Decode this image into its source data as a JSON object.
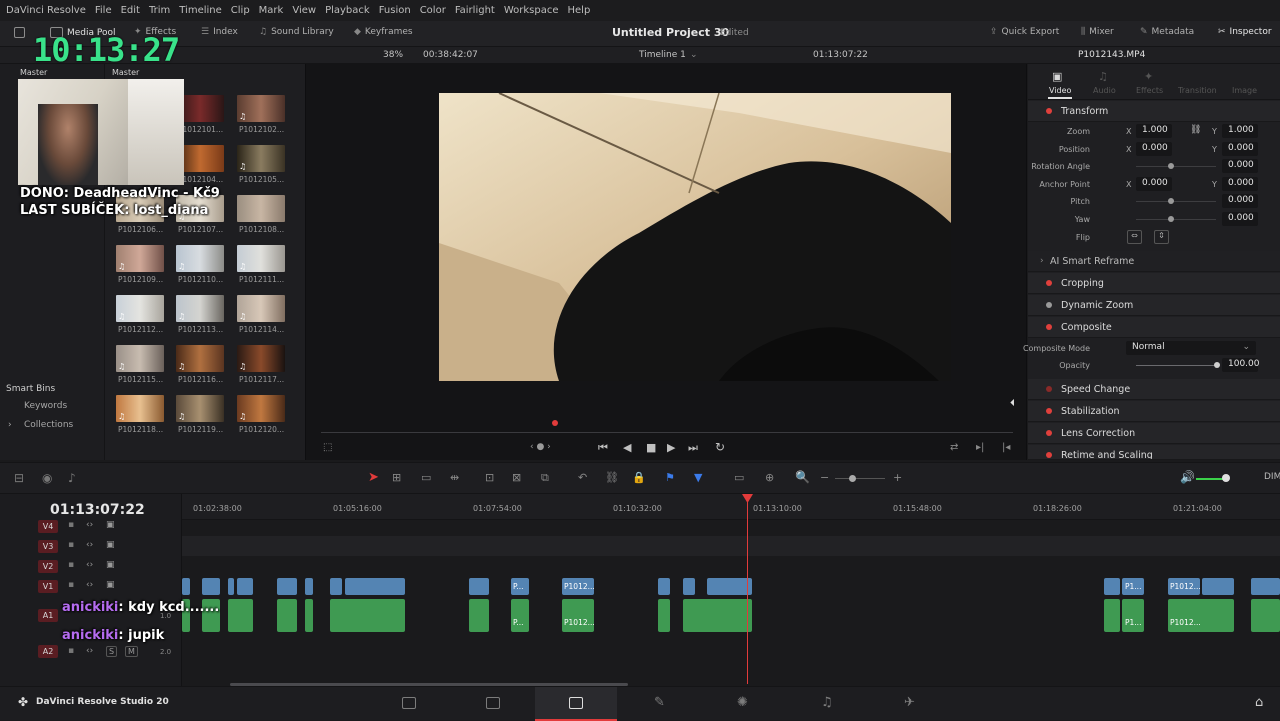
{
  "menu": [
    "DaVinci Resolve",
    "File",
    "Edit",
    "Trim",
    "Timeline",
    "Clip",
    "Mark",
    "View",
    "Playback",
    "Fusion",
    "Color",
    "Fairlight",
    "Workspace",
    "Help"
  ],
  "toolbar": {
    "media_pool": "Media Pool",
    "effects": "Effects",
    "index": "Index",
    "sound_library": "Sound Library",
    "keyframes": "Keyframes",
    "project_title": "Untitled Project 30",
    "edited": "Edited",
    "quick_export": "Quick Export",
    "mixer": "Mixer",
    "metadata": "Metadata",
    "inspector": "Inspector"
  },
  "viewerbar": {
    "zoom": "38%",
    "src_timecode": "00:38:42:07",
    "timeline_name": "Timeline 1",
    "rec_timecode": "01:13:07:22",
    "clip_name": "P1012143.MP4"
  },
  "mediapool": {
    "bin_master_left": "Master",
    "bin_master_right": "Master",
    "smart_bins": "Smart Bins",
    "keywords": "Keywords",
    "collections": "Collections",
    "clips": [
      "P1012101...",
      "P1012102...",
      "P1012104...",
      "P1012105...",
      "P1012106...",
      "P1012107...",
      "P1012108...",
      "P1012109...",
      "P1012110...",
      "P1012111...",
      "P1012112...",
      "P1012113...",
      "P1012114...",
      "P1012115...",
      "P1012116...",
      "P1012117...",
      "P1012118...",
      "P1012119...",
      "P1012120..."
    ]
  },
  "overlay": {
    "clock": "10:13:27",
    "dono": "DONO: DeadheadVinc - Kč9",
    "last_sub": "LAST SUBÍČEK: lost_diana",
    "chat1_user": "anickiki",
    "chat1_msg": ": kdy kcd.......",
    "chat2_user": "anickiki",
    "chat2_msg": ": jupik"
  },
  "inspector": {
    "tabs": [
      "Video",
      "Audio",
      "Effects",
      "Transition",
      "Image"
    ],
    "transform": "Transform",
    "zoom_label": "Zoom",
    "zoom_x": "1.000",
    "zoom_y": "1.000",
    "position_label": "Position",
    "position_x": "0.000",
    "position_y": "0.000",
    "rotation_label": "Rotation Angle",
    "rotation": "0.000",
    "anchor_label": "Anchor Point",
    "anchor_x": "0.000",
    "anchor_y": "0.000",
    "pitch_label": "Pitch",
    "pitch": "0.000",
    "yaw_label": "Yaw",
    "yaw": "0.000",
    "flip_label": "Flip",
    "ai_reframe": "AI Smart Reframe",
    "cropping": "Cropping",
    "dynamic_zoom": "Dynamic Zoom",
    "composite": "Composite",
    "composite_mode_label": "Composite Mode",
    "composite_mode": "Normal",
    "opacity_label": "Opacity",
    "opacity": "100.00",
    "speed_change": "Speed Change",
    "stabilization": "Stabilization",
    "lens_correction": "Lens Correction",
    "retime": "Retime and Scaling",
    "axis_x": "X",
    "axis_y": "Y"
  },
  "timeline": {
    "timecode": "01:13:07:22",
    "ruler": [
      "01:02:38:00",
      "01:05:16:00",
      "01:07:54:00",
      "01:10:32:00",
      "01:13:10:00",
      "01:15:48:00",
      "01:18:26:00",
      "01:21:04:00"
    ],
    "tracks": [
      "V4",
      "V3",
      "V2",
      "V1",
      "A1",
      "A2"
    ],
    "a1_level": "1.0",
    "a2_level": "2.0",
    "solo": "S",
    "mute": "M",
    "clip_labels": [
      "P...",
      "P1012...",
      "P1...",
      "P1012..."
    ],
    "dim": "DIM"
  },
  "footer": {
    "app_name": "DaVinci Resolve Studio 20"
  },
  "colors": {
    "accent_red": "#e23b3b",
    "clock_green": "#39e28a",
    "video_clip": "#5484b3",
    "audio_clip": "#3f9a52",
    "chat_purple": "#b56cf0"
  }
}
